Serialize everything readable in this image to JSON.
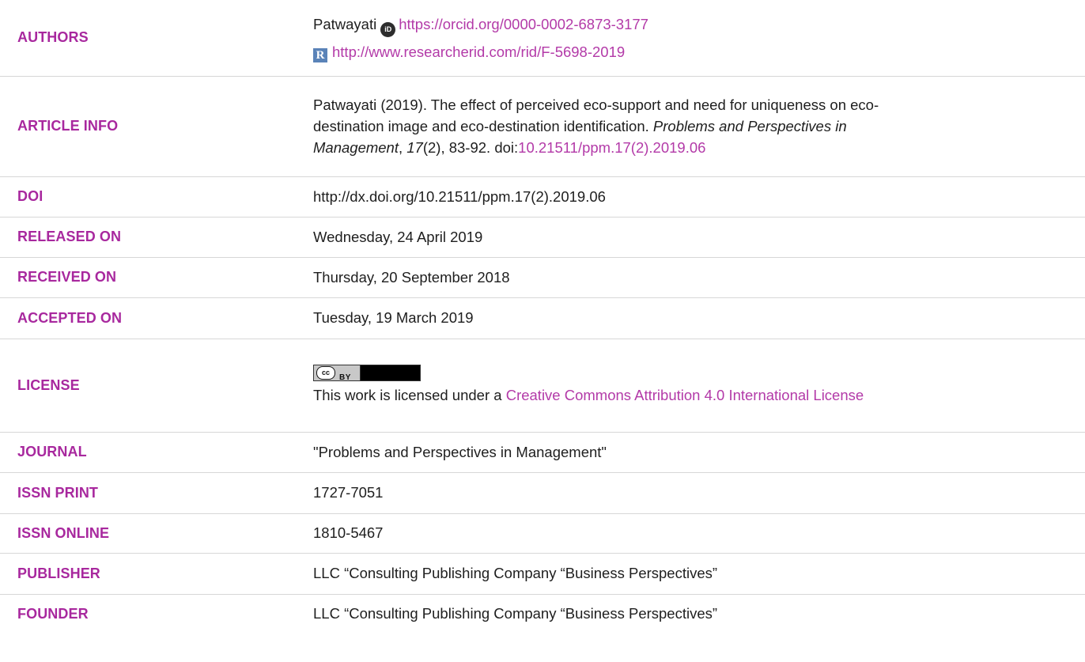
{
  "authors": {
    "label": "AUTHORS",
    "name": "Patwayati",
    "orcid_url": "https://orcid.org/0000-0002-6873-3177",
    "researcherid_url": "http://www.researcherid.com/rid/F-5698-2019"
  },
  "article_info": {
    "label": "ARTICLE INFO",
    "citation_pre": "Patwayati (2019). The effect of perceived eco-support and need for uniqueness on eco-destination image and eco-destination identification.",
    "journal_italic": "Problems and Perspectives in Management",
    "sep1": ",",
    "volume_italic": "17",
    "issue_pages": "(2), 83-92. doi:",
    "doi_link": "10.21511/ppm.17(2).2019.06"
  },
  "doi": {
    "label": "DOI",
    "value": "http://dx.doi.org/10.21511/ppm.17(2).2019.06"
  },
  "released": {
    "label": "RELEASED ON",
    "value": "Wednesday, 24 April 2019"
  },
  "received": {
    "label": "RECEIVED ON",
    "value": "Thursday, 20 September 2018"
  },
  "accepted": {
    "label": "ACCEPTED ON",
    "value": "Tuesday, 19 March 2019"
  },
  "license": {
    "label": "LICENSE",
    "badge_cc": "cc",
    "badge_by": "BY",
    "text_pre": "This work is licensed under a",
    "link": "Creative Commons Attribution 4.0 International License"
  },
  "journal": {
    "label": "JOURNAL",
    "value": "\"Problems and Perspectives in Management\""
  },
  "issn_print": {
    "label": "ISSN PRINT",
    "value": "1727-7051"
  },
  "issn_online": {
    "label": "ISSN ONLINE",
    "value": "1810-5467"
  },
  "publisher": {
    "label": "PUBLISHER",
    "value": "LLC “Consulting Publishing Company “Business Perspectives”"
  },
  "founder": {
    "label": "FOUNDER",
    "value": "LLC “Consulting Publishing Company “Business Perspectives”"
  },
  "colors": {
    "label": "#a8289e",
    "link": "#b33aa8",
    "divider": "#d7d7d7"
  },
  "icons": {
    "orcid": "orcid-icon",
    "researcherid": "researcherid-icon",
    "license_badge": "cc-by-badge"
  }
}
